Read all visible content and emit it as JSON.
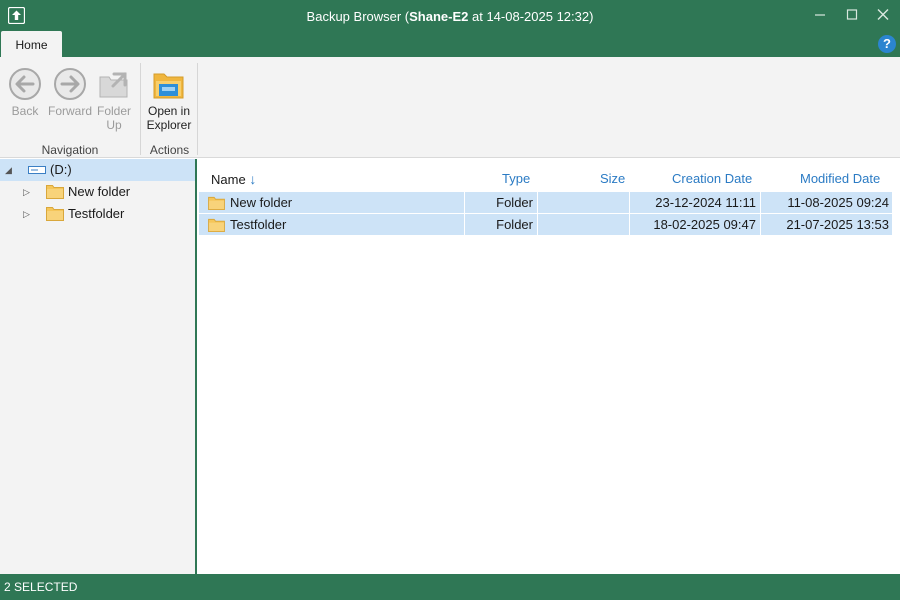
{
  "window": {
    "title_prefix": "Backup Browser (",
    "title_host": "Shane-E2",
    "title_suffix": " at 14-08-2025 12:32)",
    "icons": [
      "app-icon",
      "minimize-icon",
      "maximize-icon",
      "close-icon"
    ]
  },
  "tabs": [
    {
      "label": "Home"
    }
  ],
  "help": {
    "label": "?"
  },
  "ribbon": {
    "groups": [
      {
        "label": "Navigation",
        "buttons": [
          {
            "label_line1": "Back",
            "label_line2": "",
            "icon": "back-arrow-icon",
            "enabled": false
          },
          {
            "label_line1": "Forward",
            "label_line2": "",
            "icon": "forward-arrow-icon",
            "enabled": false
          },
          {
            "label_line1": "Folder",
            "label_line2": "Up",
            "icon": "folder-up-icon",
            "enabled": false
          }
        ]
      },
      {
        "label": "Actions",
        "buttons": [
          {
            "label_line1": "Open in",
            "label_line2": "Explorer",
            "icon": "open-in-explorer-icon",
            "enabled": true
          }
        ]
      }
    ]
  },
  "tree": {
    "root": {
      "label": "(D:)",
      "icon": "drive-icon",
      "expanded": true,
      "selected": true
    },
    "children": [
      {
        "label": "New folder",
        "icon": "folder-icon"
      },
      {
        "label": "Testfolder",
        "icon": "folder-icon"
      }
    ]
  },
  "list": {
    "columns": {
      "name": "Name",
      "type": "Type",
      "size": "Size",
      "creation": "Creation Date",
      "modified": "Modified Date"
    },
    "sort_indicator": "↓",
    "rows": [
      {
        "name": "New folder",
        "type": "Folder",
        "size": "",
        "creation": "23-12-2024 11:11",
        "modified": "11-08-2025 09:24",
        "selected": true
      },
      {
        "name": "Testfolder",
        "type": "Folder",
        "size": "",
        "creation": "18-02-2025 09:47",
        "modified": "21-07-2025 13:53",
        "selected": true
      }
    ]
  },
  "status": {
    "text": "2 SELECTED"
  },
  "colors": {
    "accent_green": "#2f7755",
    "selection_blue": "#cde3f7",
    "header_blue": "#2b7bc4",
    "folder_yellow": "#f5c65a"
  }
}
